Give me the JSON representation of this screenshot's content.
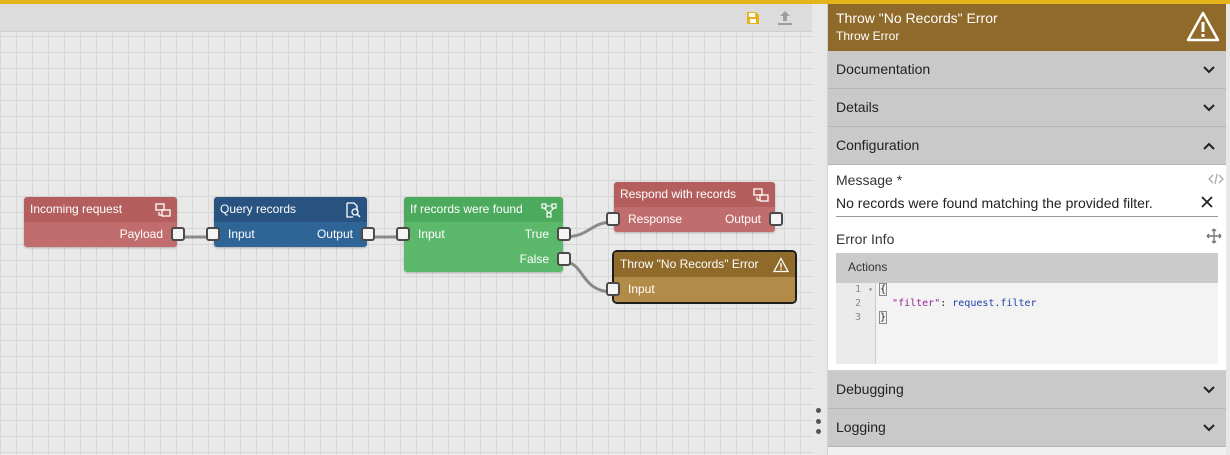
{
  "canvas": {
    "toolbar": {
      "save_icon": "save-icon",
      "export_icon": "upload-icon"
    },
    "nodes": {
      "incoming": {
        "title": "Incoming request",
        "output": "Payload",
        "icon": "trigger-icon"
      },
      "query": {
        "title": "Query records",
        "input": "Input",
        "output": "Output",
        "icon": "search-doc-icon"
      },
      "conditional": {
        "title": "If records were found",
        "input": "Input",
        "out_true": "True",
        "out_false": "False",
        "icon": "branch-icon"
      },
      "respond": {
        "title": "Respond with records",
        "input": "Response",
        "output": "Output",
        "icon": "trigger-icon"
      },
      "throw": {
        "title": "Throw \"No Records\" Error",
        "input": "Input",
        "icon": "warning-icon"
      }
    }
  },
  "panel": {
    "title": "Throw \"No Records\" Error",
    "subtitle": "Throw Error",
    "header_icon": "warning-icon",
    "sections": {
      "documentation": "Documentation",
      "details": "Details",
      "configuration": "Configuration",
      "debugging": "Debugging",
      "logging": "Logging"
    },
    "config": {
      "message_label": "Message *",
      "message_value": "No records were found matching the provided filter.",
      "error_info_label": "Error Info",
      "editor_tab": "Actions",
      "code": {
        "line1_num": "1",
        "line2_num": "2",
        "line3_num": "3",
        "line1": "{",
        "line2_key": "\"filter\"",
        "line2_sep": ": ",
        "line2_val": "request.filter",
        "line3": "}"
      }
    }
  },
  "colors": {
    "accent": "#e4b418",
    "throw_header": "#8f6a2a",
    "trigger": "#c26d6d",
    "query": "#2f6496",
    "conditional": "#5cb86b"
  }
}
